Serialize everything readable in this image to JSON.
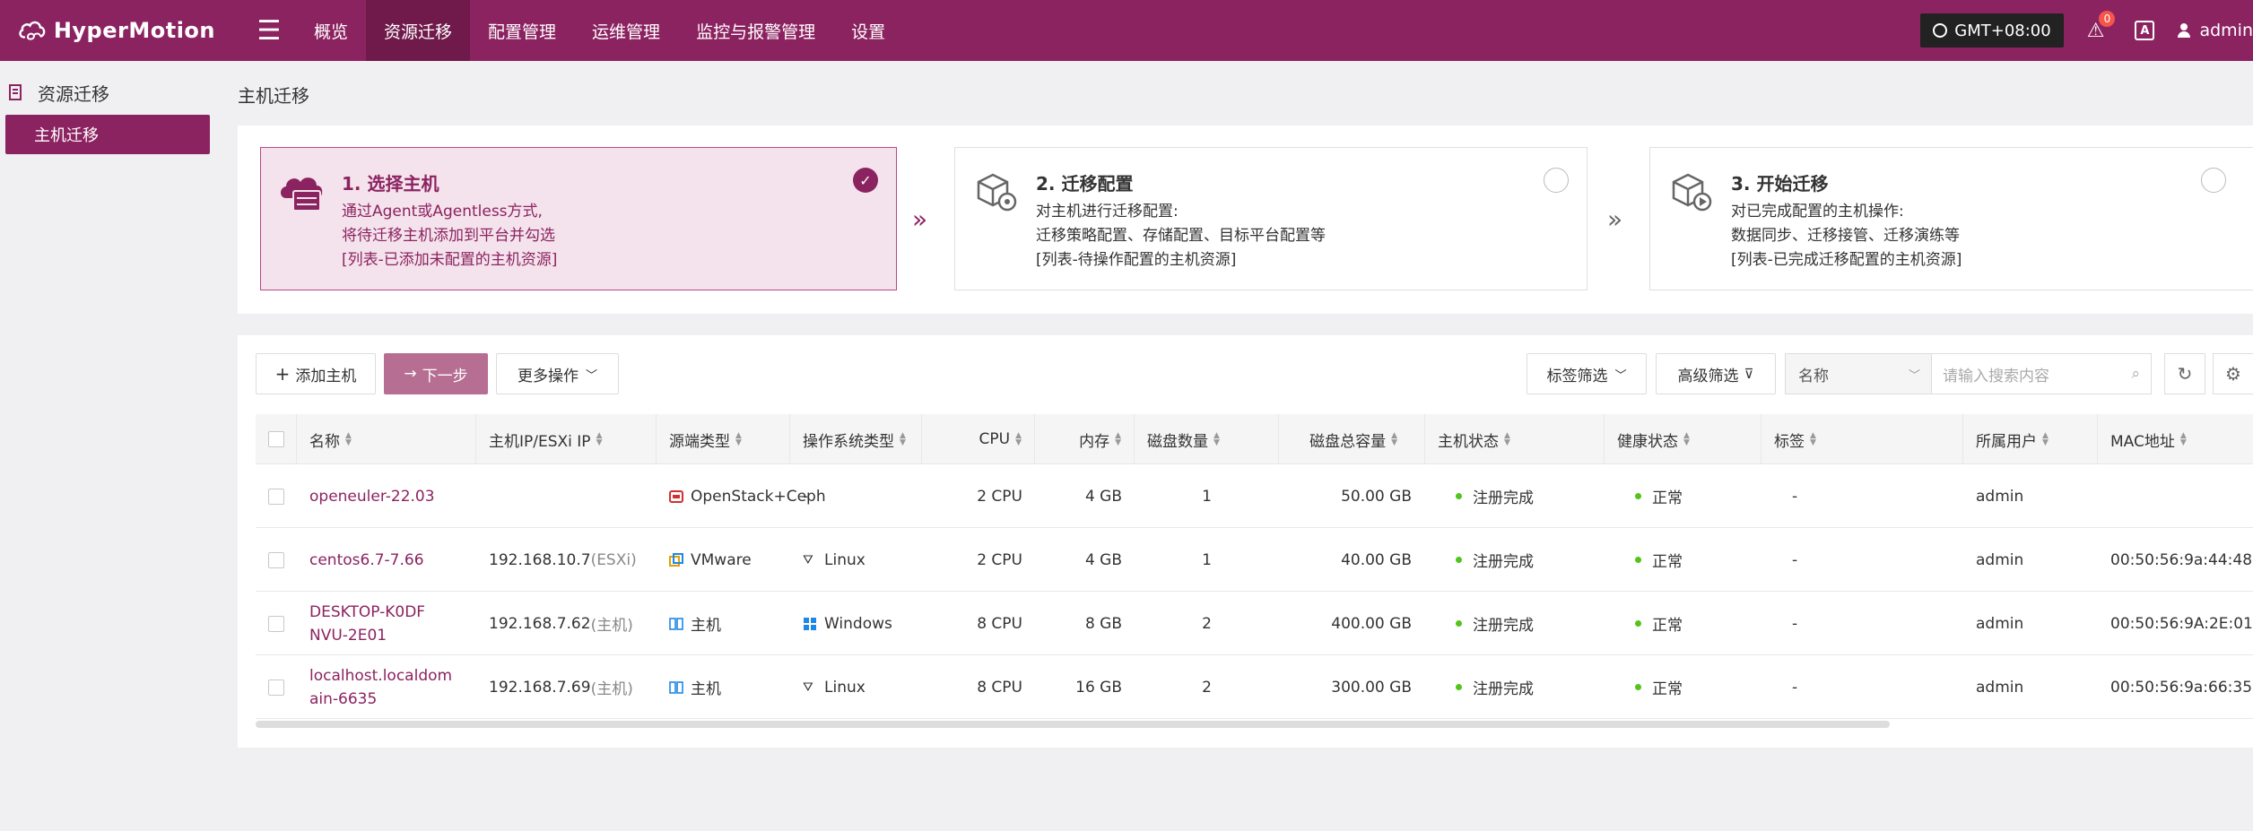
{
  "app": {
    "name": "HyperMotion"
  },
  "nav": [
    "概览",
    "资源迁移",
    "配置管理",
    "运维管理",
    "监控与报警管理",
    "设置"
  ],
  "header_right": {
    "timezone": "GMT+08:00",
    "notif_count": "0",
    "lang_label": "A",
    "user": "admin"
  },
  "sidebar": {
    "group": "资源迁移",
    "items": [
      "主机迁移"
    ]
  },
  "page": {
    "title": "主机迁移"
  },
  "steps": [
    {
      "title": "1. 选择主机",
      "lines": [
        "通过Agent或Agentless方式,",
        "将待迁移主机添加到平台并勾选",
        "[列表-已添加未配置的主机资源]"
      ],
      "selected": true
    },
    {
      "title": "2. 迁移配置",
      "lines": [
        "对主机进行迁移配置:",
        "迁移策略配置、存储配置、目标平台配置等",
        "[列表-待操作配置的主机资源]"
      ],
      "selected": false
    },
    {
      "title": "3. 开始迁移",
      "lines": [
        "对已完成配置的主机操作:",
        "数据同步、迁移接管、迁移演练等",
        "[列表-已完成迁移配置的主机资源]"
      ],
      "selected": false
    }
  ],
  "toolbar": {
    "add_host": "添加主机",
    "next": "下一步",
    "more": "更多操作",
    "tag_filter": "标签筛选",
    "adv_filter": "高级筛选",
    "search_field": "名称",
    "search_placeholder": "请输入搜索内容"
  },
  "table": {
    "columns": [
      "名称",
      "主机IP/ESXi IP",
      "源端类型",
      "操作系统类型",
      "CPU",
      "内存",
      "磁盘数量",
      "磁盘总容量",
      "主机状态",
      "健康状态",
      "标签",
      "所属用户",
      "MAC地址"
    ],
    "rows": [
      {
        "name": "openeuler-22.03",
        "ip": "",
        "ip_suffix": "",
        "source": "OpenStack+Ceph",
        "source_icon": "openstack-icon",
        "os": "-",
        "os_icon": "",
        "cpu": "2 CPU",
        "mem": "4 GB",
        "disks": "1",
        "capacity": "50.00 GB",
        "status": "注册完成",
        "health": "正常",
        "tags": "-",
        "owner": "admin",
        "mac": ""
      },
      {
        "name": "centos6.7-7.66",
        "ip": "192.168.10.7",
        "ip_suffix": "(ESXi)",
        "source": "VMware",
        "source_icon": "vmware-icon",
        "os": "Linux",
        "os_icon": "linux-icon",
        "cpu": "2 CPU",
        "mem": "4 GB",
        "disks": "1",
        "capacity": "40.00 GB",
        "status": "注册完成",
        "health": "正常",
        "tags": "-",
        "owner": "admin",
        "mac": "00:50:56:9a:44:48"
      },
      {
        "name": "DESKTOP-K0DFNVU-2E01",
        "ip": "192.168.7.62",
        "ip_suffix": "(主机)",
        "source": "主机",
        "source_icon": "host-icon",
        "os": "Windows",
        "os_icon": "windows-icon",
        "cpu": "8 CPU",
        "mem": "8 GB",
        "disks": "2",
        "capacity": "400.00 GB",
        "status": "注册完成",
        "health": "正常",
        "tags": "-",
        "owner": "admin",
        "mac": "00:50:56:9A:2E:01"
      },
      {
        "name": "localhost.localdomain-6635",
        "ip": "192.168.7.69",
        "ip_suffix": "(主机)",
        "source": "主机",
        "source_icon": "host-icon",
        "os": "Linux",
        "os_icon": "linux-icon",
        "cpu": "8 CPU",
        "mem": "16 GB",
        "disks": "2",
        "capacity": "300.00 GB",
        "status": "注册完成",
        "health": "正常",
        "tags": "-",
        "owner": "admin",
        "mac": "00:50:56:9a:66:35"
      }
    ]
  },
  "colors": {
    "brand": "#8c2361",
    "brand_dark": "#6f1a4b",
    "primary_btn": "#b66e92",
    "status_green": "#52c41a"
  }
}
